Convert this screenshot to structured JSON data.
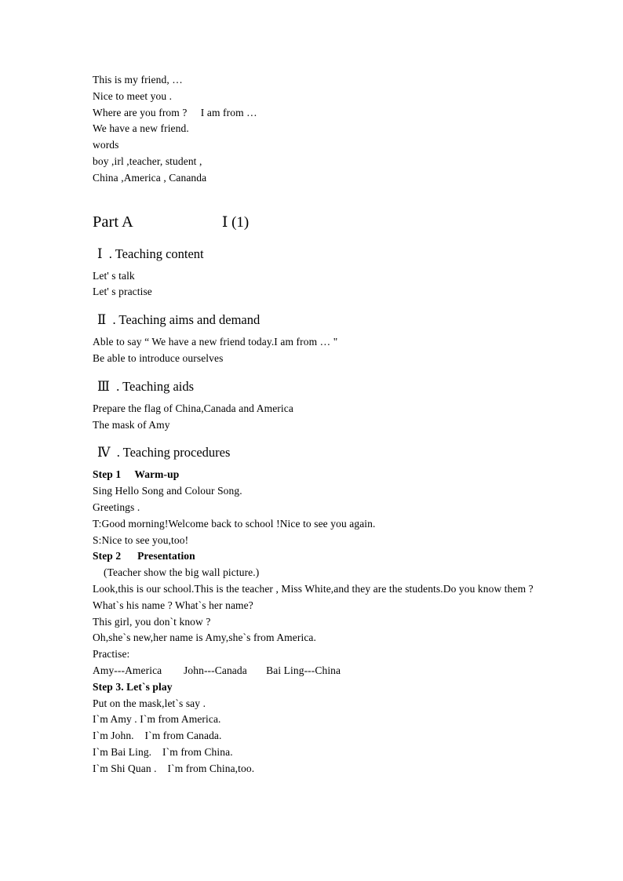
{
  "document": {
    "intro_lines": [
      "This is my friend, …",
      "Nice to meet you .",
      "Where are you from ?     I am from …",
      "We have a new friend.",
      "words",
      "boy ,irl ,teacher, student ,",
      "China ,America , Cananda"
    ],
    "part_heading": {
      "title": "Part A",
      "right_label": "Ⅰ (1)"
    },
    "sections": [
      {
        "numeral": "Ⅰ",
        "heading": "Ⅰ  . Teaching content",
        "lines": [
          "Let' s talk",
          "Let' s practise"
        ]
      },
      {
        "numeral": "Ⅱ",
        "heading": "Ⅱ  . Teaching aims and demand",
        "lines": [
          "Able to say “ We have a new friend today.I am from … \"",
          "Be able to introduce ourselves"
        ]
      },
      {
        "numeral": "Ⅲ",
        "heading": "Ⅲ  . Teaching aids",
        "lines": [
          "Prepare the flag of China,Canada and America",
          "The mask of Amy"
        ]
      },
      {
        "numeral": "Ⅳ",
        "heading": "Ⅳ  . Teaching procedures",
        "lines": []
      }
    ],
    "procedures": {
      "step1_label": "Step 1     Warm-up",
      "step1_lines": [
        "Sing Hello Song and Colour Song.",
        "Greetings .",
        "T:Good morning!Welcome back to school !Nice to see you again.",
        "S:Nice to see you,too!"
      ],
      "step2_label": "Step 2      Presentation",
      "step2_note": "(Teacher show the big wall picture.)",
      "step2_paragraph": "Look,this is our school.This is the teacher , Miss White,and they are the students.Do you know them ?What`s his name ?   What`s her name?",
      "step2_lines": [
        "This girl, you don`t know ?",
        "Oh,she`s new,her name is Amy,she`s from America.",
        "Practise:",
        "Amy---America        John---Canada       Bai Ling---China"
      ],
      "step3_label": "Step 3. Let`s play",
      "step3_lines": [
        "Put on the mask,let`s say .",
        "I`m Amy . I`m from America.",
        "I`m John.    I`m from Canada.",
        "I`m Bai Ling.    I`m from China.",
        "I`m Shi Quan .    I`m from China,too."
      ]
    }
  }
}
